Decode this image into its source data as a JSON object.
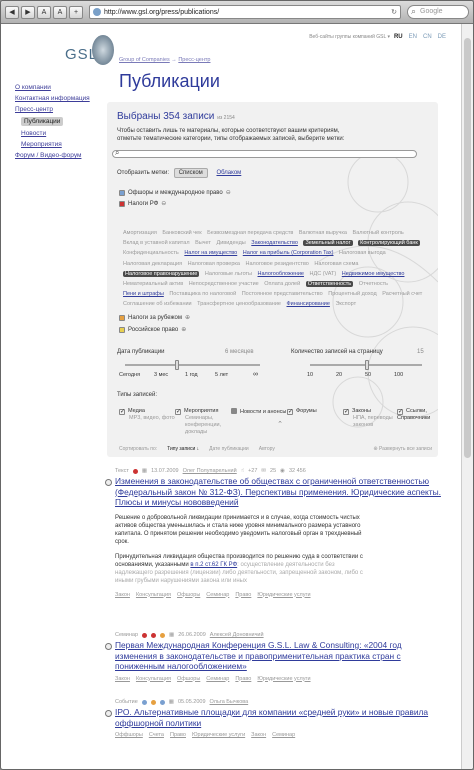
{
  "browser": {
    "back": "◀",
    "forward": "▶",
    "reader": "A",
    "zoom": "A",
    "add": "+",
    "url": "http://www.gsl.org/press/publications/",
    "search": "Google",
    "reload": "↻"
  },
  "header": {
    "logo": "GSL",
    "top_links": "Веб-сайты группы компаний GSL ▾",
    "languages": [
      "RU",
      "EN",
      "CN",
      "DE"
    ]
  },
  "breadcrumb": [
    "Group of Companies",
    "Пресс-центр"
  ],
  "title": "Публикации",
  "nav": [
    {
      "label": "О компании",
      "sub": false,
      "sel": false
    },
    {
      "label": "Контактная информация",
      "sub": false,
      "sel": false
    },
    {
      "label": "Пресс-центр",
      "sub": false,
      "sel": false
    },
    {
      "label": "Публикации",
      "sub": true,
      "sel": true
    },
    {
      "label": "Новости",
      "sub": true,
      "sel": false
    },
    {
      "label": "Мероприятия",
      "sub": true,
      "sel": false
    },
    {
      "label": "Форум / Видео-форум",
      "sub": false,
      "sel": false
    }
  ],
  "filter": {
    "selected": "Выбраны 354 записи",
    "selected_small": "из 2154",
    "desc": "Чтобы оставить лишь те материалы, которые соответствуют вашим критериям, отметьте тематические категории, типы отображаемых записей, выберите метки:",
    "show_label": "Отобразить метки:",
    "show_list": "Списком",
    "show_cloud": "Облаком",
    "cats": [
      {
        "label": "Офшоры и международное право",
        "color": "blue"
      },
      {
        "label": "Налоги РФ",
        "color": "red"
      },
      {
        "label": "Налоги за рубежом",
        "color": "orange"
      },
      {
        "label": "Российское право",
        "color": "yellow"
      }
    ],
    "tags": [
      [
        "Амортизация",
        "g"
      ],
      [
        "Банковский чек",
        "g"
      ],
      [
        "Безвозмездная передача средств",
        "g"
      ],
      [
        "Валютная выручка",
        "g"
      ],
      [
        "Валютный контроль",
        "g"
      ],
      [
        "Вклад в уставной капитал",
        "g"
      ],
      [
        "Вычет",
        "g"
      ],
      [
        "Дивиденды",
        "g"
      ],
      [
        "Законодательство",
        "d"
      ],
      [
        "Земельный налог",
        "h"
      ],
      [
        "Контролирующий банк",
        "h"
      ],
      [
        "Конфиденциальность",
        "g"
      ],
      [
        "Налог на имущество",
        "d"
      ],
      [
        "Налог на прибыль (Corporation Tax)",
        "d"
      ],
      [
        "Налоговая выгода",
        "g"
      ],
      [
        "Налоговая декларация",
        "g"
      ],
      [
        "Налоговая проверка",
        "g"
      ],
      [
        "Налоговое резидентство",
        "g"
      ],
      [
        "Налоговая схема",
        "g"
      ],
      [
        "Налоговое правонарушение",
        "h"
      ],
      [
        "Налоговые льготы",
        "g"
      ],
      [
        "Налогообложение",
        "d"
      ],
      [
        "НДС (VAT)",
        "g"
      ],
      [
        "Недвижимое имущество",
        "d"
      ],
      [
        "Нематериальный актив",
        "g"
      ],
      [
        "Непосредственное участие",
        "g"
      ],
      [
        "Оплата долей",
        "g"
      ],
      [
        "Ответственность",
        "h"
      ],
      [
        "Отчетность",
        "g"
      ],
      [
        "Пени и штрафы",
        "d"
      ],
      [
        "Поставщика по налоговой",
        "g"
      ],
      [
        "Постоянное представительство",
        "g"
      ],
      [
        "Процентный доход",
        "g"
      ],
      [
        "Расчетный счет",
        "g"
      ],
      [
        "Соглашение об избежании",
        "g"
      ],
      [
        "Трансфертное ценообразование",
        "g"
      ],
      [
        "Финансирование",
        "d"
      ],
      [
        "Экспорт",
        "g"
      ]
    ],
    "pub_date_label": "Дата публикации",
    "pub_date_value": "6 месяцев",
    "pub_ticks": [
      "Сегодня",
      "3 мес",
      "1 год",
      "5 лет",
      "∞"
    ],
    "count_label": "Количество записей на страницу",
    "count_value": "15",
    "count_ticks": [
      "10",
      "20",
      "50",
      "100"
    ],
    "types_label": "Типы записей:",
    "types": [
      {
        "label": "Медиа",
        "sub": "MP3, видео, фото",
        "color": "plain"
      },
      {
        "label": "Мероприятия",
        "sub": "Семинары, конференции, доклады",
        "color": "plain"
      },
      {
        "label": "Новости и анонсы",
        "sub": "",
        "color": "gray"
      },
      {
        "label": "Форумы",
        "sub": "",
        "color": "plain"
      },
      {
        "label": "Законы",
        "sub": "НПА, переводы законов",
        "color": "plain"
      },
      {
        "label": "Ссылки, Справочники",
        "sub": "",
        "color": "plain"
      }
    ]
  },
  "sort": {
    "label": "Сортировать по:",
    "options": [
      "Типу записи ↓",
      "Дате публикации",
      "Автору"
    ],
    "expand": "Развернуть все записи"
  },
  "entries": [
    {
      "type": "Текст",
      "date": "13.07.2009",
      "author": "Олег Полупарельний",
      "votes": "+27",
      "comments": "25",
      "views": "32 456",
      "title": "Изменения в законодательстве об обществах с ограниченной ответственностью (Федеральный закон № 312-ФЗ). Перспективы применения. Юридические аспекты. Плюсы и минусы нововведений",
      "body1": "Решение о добровольной ликвидации принимается и в случае, когда стоимость чистых активов общества уменьшилась и стала ниже уровня минимального размера уставного капитала. О принятом решении необходимо уведомить налоговый орган в трехдневный срок.",
      "body2a": "Принудительная ликвидация общества производится по решению суда в соответствии с основаниями, указанными ",
      "body2link": "в п.2 ст.62 ГК РФ",
      "body2b": ": осуществление деятельности без надлежащего разрешения (лицензии) либо деятельности, запрещенной законом, либо с иными грубыми нарушениями закона или иных",
      "tags": [
        "Закон",
        "Консультация",
        "Офшоры",
        "Семинар",
        "Право",
        "Юридические услуги"
      ]
    },
    {
      "type": "Семинар",
      "date": "26.06.2009",
      "author": "Алексей Доновничий",
      "title": "Первая Международная Конференция G.S.L. Law & Consulting: «2004 год изменения в законодательстве и правоприменительная практика стран с пониженным налогообложением»",
      "tags": [
        "Закон",
        "Консультация",
        "Офшоры",
        "Семинар",
        "Право",
        "Юридические услуги"
      ]
    },
    {
      "type": "Событие",
      "date": "05.05.2009",
      "author": "Ольга Бычкова",
      "title": "IPO. Альтернативные площадки для компании «средней руки» и новые правила оффшорной политики",
      "tags": [
        "Оффшоры",
        "Счета",
        "Право",
        "Юридические услуги",
        "Закон",
        "Семинар"
      ]
    }
  ]
}
